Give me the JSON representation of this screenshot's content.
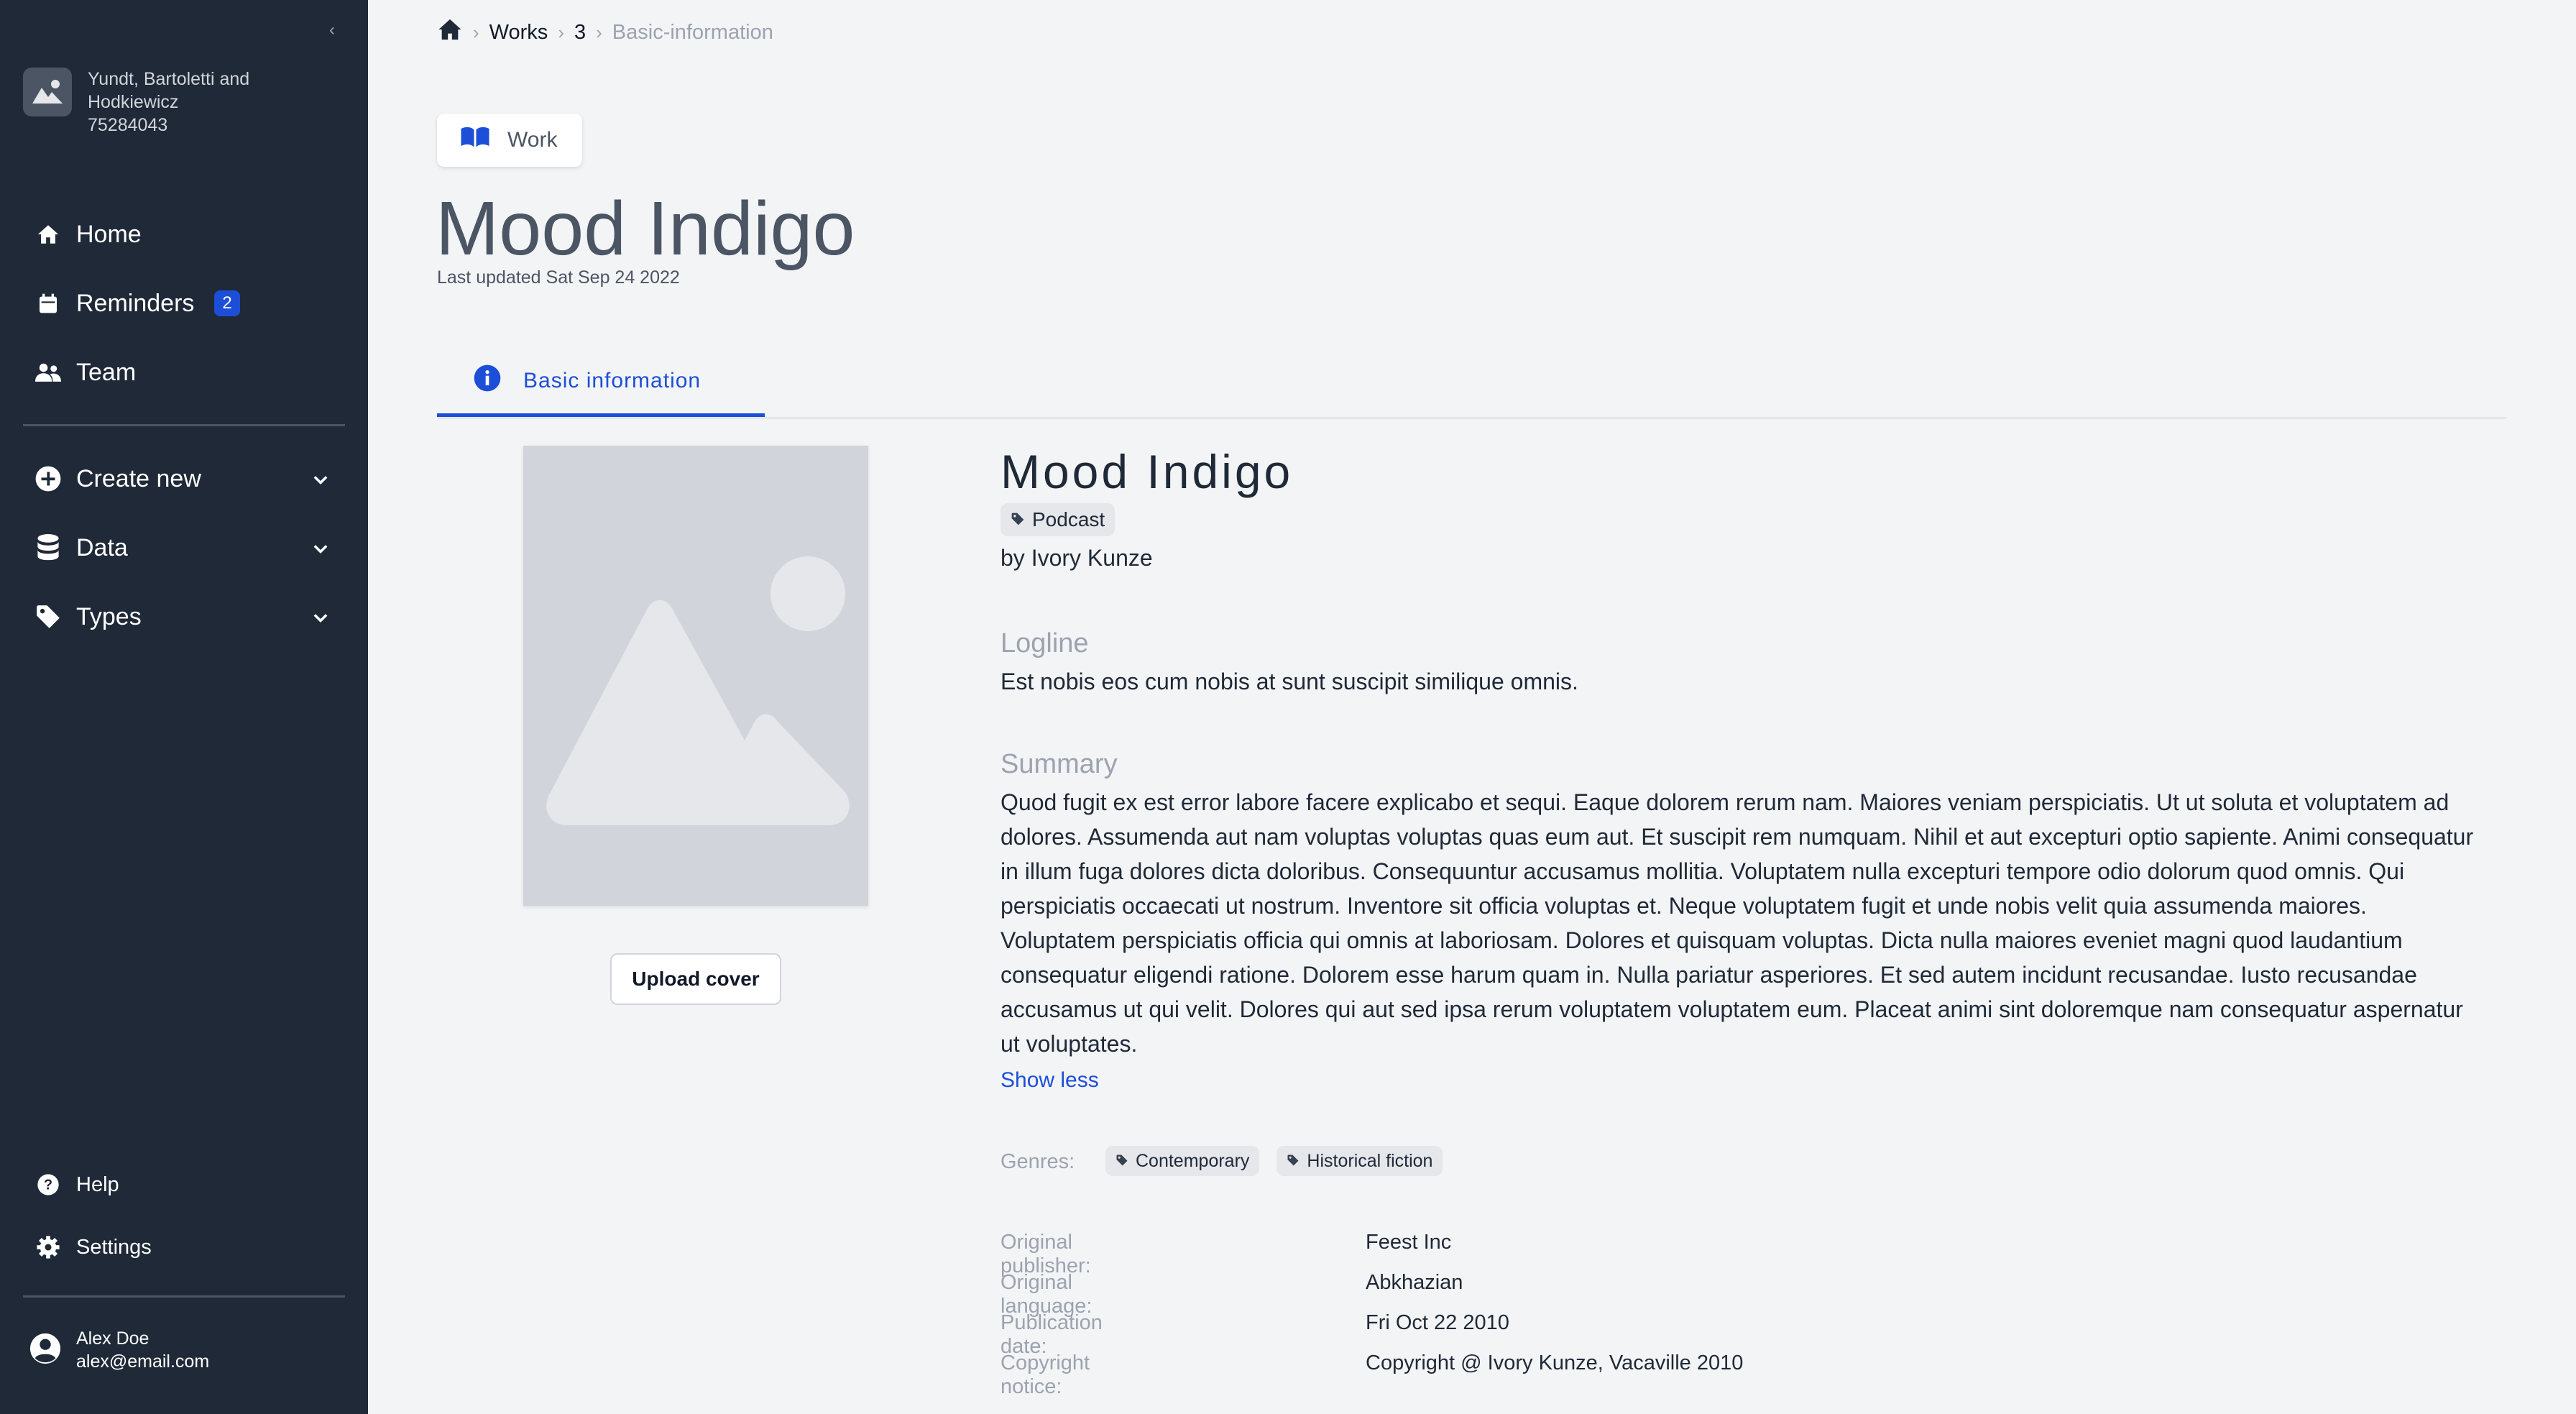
{
  "sidebar": {
    "collapse_glyph": "‹",
    "org": {
      "name": "Yundt, Bartoletti and Hodkiewicz",
      "id": "75284043"
    },
    "primary": [
      {
        "label": "Home",
        "icon": "home-icon"
      },
      {
        "label": "Reminders",
        "icon": "calendar-icon",
        "badge": "2"
      },
      {
        "label": "Team",
        "icon": "users-icon"
      }
    ],
    "secondary": [
      {
        "label": "Create new",
        "icon": "plus-circle-icon"
      },
      {
        "label": "Data",
        "icon": "database-icon"
      },
      {
        "label": "Types",
        "icon": "tag-icon"
      }
    ],
    "footer": [
      {
        "label": "Help",
        "icon": "help-icon"
      },
      {
        "label": "Settings",
        "icon": "gear-icon"
      }
    ],
    "user": {
      "name": "Alex Doe",
      "email": "alex@email.com"
    }
  },
  "breadcrumb": {
    "items": [
      "Works",
      "3",
      "Basic-information"
    ]
  },
  "header": {
    "chip": "Work",
    "title": "Mood Indigo",
    "last_updated": "Last updated Sat Sep 24 2022"
  },
  "tabs": [
    {
      "label": "Basic information",
      "active": true
    }
  ],
  "cover": {
    "upload_label": "Upload cover"
  },
  "work": {
    "title": "Mood Indigo",
    "type": "Podcast",
    "byline": "by Ivory Kunze",
    "logline_heading": "Logline",
    "logline": "Est nobis eos cum nobis at sunt suscipit similique omnis.",
    "summary_heading": "Summary",
    "summary": "Quod fugit ex est error labore facere explicabo et sequi. Eaque dolorem rerum nam. Maiores veniam perspiciatis. Ut ut soluta et voluptatem ad dolores. Assumenda aut nam voluptas voluptas quas eum aut. Et suscipit rem numquam. Nihil et aut excepturi optio sapiente. Animi consequatur in illum fuga dolores dicta doloribus. Consequuntur accusamus mollitia. Voluptatem nulla excepturi tempore odio dolorum quod omnis. Qui perspiciatis occaecati ut nostrum. Inventore sit officia voluptas et. Neque voluptatem fugit et unde nobis velit quia assumenda maiores. Voluptatem perspiciatis officia qui omnis at laboriosam. Dolores et quisquam voluptas. Dicta nulla maiores eveniet magni quod laudantium consequatur eligendi ratione. Dolorem esse harum quam in. Nulla pariatur asperiores. Et sed autem incidunt recusandae. Iusto recusandae accusamus ut qui velit. Dolores qui aut sed ipsa rerum voluptatem voluptatem eum. Placeat animi sint doloremque nam consequatur aspernatur ut voluptates.",
    "show_less": "Show less",
    "genres_label": "Genres:",
    "genres": [
      "Contemporary",
      "Historical fiction"
    ],
    "meta": [
      {
        "label": "Original publisher:",
        "value": "Feest Inc"
      },
      {
        "label": "Original language:",
        "value": "Abkhazian"
      },
      {
        "label": "Publication date:",
        "value": "Fri Oct 22 2010"
      },
      {
        "label": "Copyright notice:",
        "value": "Copyright @ Ivory Kunze, Vacaville 2010"
      }
    ]
  },
  "colors": {
    "sidebar_bg": "#1f2937",
    "accent": "#1d4ed8",
    "page_bg": "#f3f4f6"
  }
}
